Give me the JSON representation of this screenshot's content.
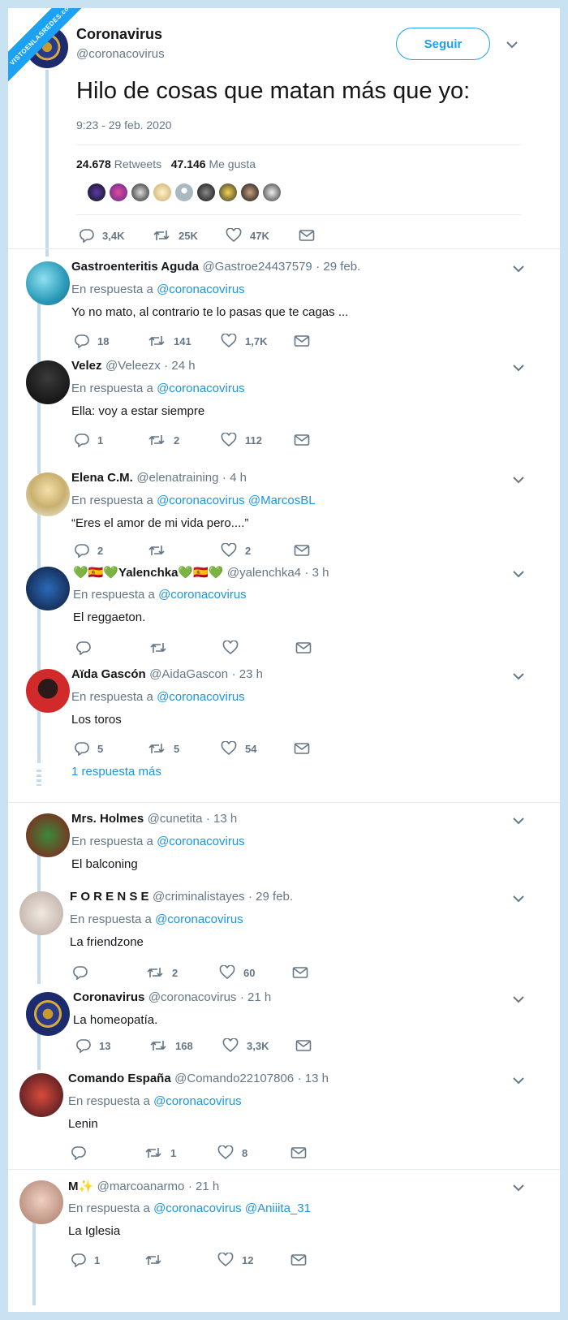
{
  "watermark": "VISTOENLASREDES.com",
  "main": {
    "name": "Coronavirus",
    "handle": "@coronacovirus",
    "follow": "Seguir",
    "text": "Hilo de cosas que matan más que yo:",
    "time": "9:23 - 29 feb. 2020",
    "retweets_count": "24.678",
    "retweets_label": "Retweets",
    "likes_count": "47.146",
    "likes_label": "Me gusta",
    "replies": "3,4K",
    "rts": "25K",
    "favs": "47K"
  },
  "colors": {
    "accent": "#1b95e0",
    "thread": "#c4dbee",
    "muted": "#657786"
  },
  "reply_prefix": "En respuesta a",
  "tweets": [
    {
      "name": "Gastroenteritis Aguda",
      "handle": "@Gastroe24437579",
      "time": "· 29 feb.",
      "mentions": "@coronacovirus",
      "text": "Yo no mato, al contrario te lo pasas que te cagas ...",
      "replies": "18",
      "rts": "141",
      "favs": "1,7K"
    },
    {
      "name": "Velez",
      "handle": "@Veleezx",
      "time": "· 24 h",
      "mentions": "@coronacovirus",
      "text": "Ella: voy a estar siempre",
      "replies": "1",
      "rts": "2",
      "favs": "112"
    },
    {
      "name": "Elena C.M.",
      "handle": "@elenatraining",
      "time": "· 4 h",
      "mentions": "@coronacovirus @MarcosBL",
      "text": "“Eres el amor de mi vida pero....”",
      "replies": "2",
      "rts": "",
      "favs": "2"
    },
    {
      "name": "💚🇪🇸💚Yalenchka💚🇪🇸💚",
      "handle": "@yalenchka4",
      "time": "· 3 h",
      "mentions": "@coronacovirus",
      "text": "El reggaeton.",
      "replies": "",
      "rts": "",
      "favs": ""
    },
    {
      "name": "Aïda Gascón",
      "handle": "@AidaGascon",
      "time": "· 23 h",
      "mentions": "@coronacovirus",
      "text": "Los toros",
      "replies": "5",
      "rts": "5",
      "favs": "54"
    },
    {
      "name": "Mrs. Holmes",
      "handle": "@cunetita",
      "time": "· 13 h",
      "mentions": "@coronacovirus",
      "text": "El balconing",
      "replies": "",
      "rts": "",
      "favs": ""
    },
    {
      "name": "F O R E N S E",
      "handle": "@criminalistayes",
      "time": "· 29 feb.",
      "mentions": "@coronacovirus",
      "text": "La friendzone",
      "replies": "",
      "rts": "2",
      "favs": "60"
    },
    {
      "name": "Coronavirus",
      "handle": "@coronacovirus",
      "time": "· 21 h",
      "mentions": "",
      "text": "La homeopatía.",
      "replies": "13",
      "rts": "168",
      "favs": "3,3K"
    },
    {
      "name": "Comando España",
      "handle": "@Comando22107806",
      "time": "· 13 h",
      "mentions": "@coronacovirus",
      "text": "Lenin",
      "replies": "",
      "rts": "1",
      "favs": "8"
    },
    {
      "name": "M✨",
      "handle": "@marcoanarmo",
      "time": "· 21 h",
      "mentions": "@coronacovirus @Aniiita_31",
      "text": "La Iglesia",
      "replies": "1",
      "rts": "",
      "favs": "12"
    }
  ],
  "more_replies": "1 respuesta más"
}
